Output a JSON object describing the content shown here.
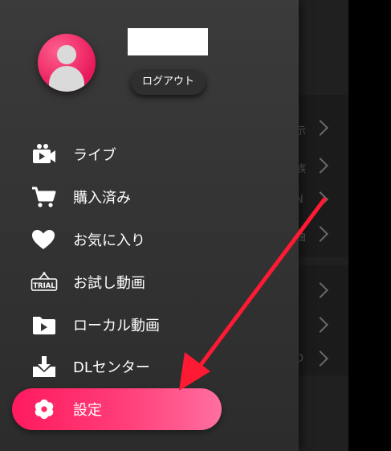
{
  "profile": {
    "logout_label": "ログアウト"
  },
  "menu": {
    "items": [
      {
        "label": "ライブ",
        "icon": "live-camera-icon"
      },
      {
        "label": "購入済み",
        "icon": "shopping-cart-icon"
      },
      {
        "label": "お気に入り",
        "icon": "heart-icon"
      },
      {
        "label": "お試し動画",
        "icon": "trial-icon"
      },
      {
        "label": "ローカル動画",
        "icon": "folder-play-icon"
      },
      {
        "label": "DLセンター",
        "icon": "download-icon"
      },
      {
        "label": "設定",
        "icon": "gear-icon",
        "selected": true
      }
    ]
  },
  "background": {
    "fragments": [
      "示",
      "族",
      "N",
      "曲",
      "",
      "",
      "D"
    ]
  },
  "colors": {
    "accent": "#ff2a68",
    "arrow": "#ff1a33",
    "drawer": "#353535",
    "text": "#ffffff"
  }
}
